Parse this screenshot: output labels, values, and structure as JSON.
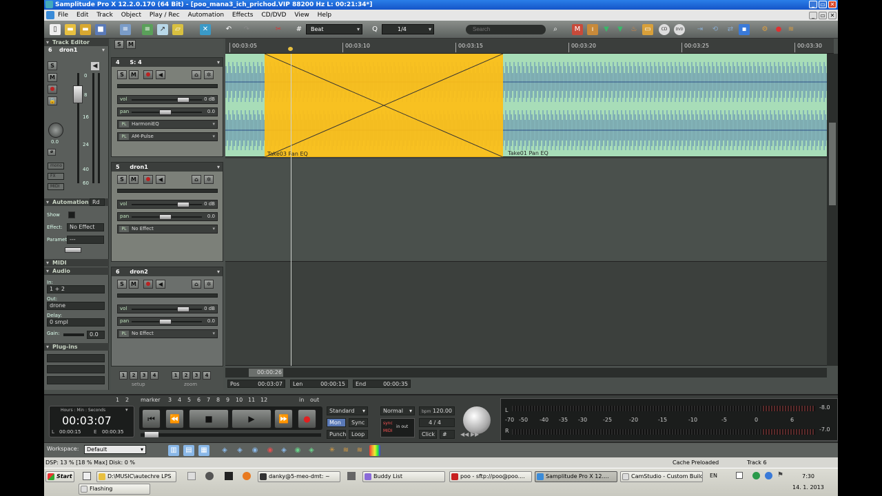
{
  "window": {
    "title": "Samplitude Pro X 12.2.0.170 (64 Bit) - [poo_mana3_ich_prichod.VIP   88200 Hz L: 00:21:34*]"
  },
  "menu": [
    "File",
    "Edit",
    "Track",
    "Object",
    "Play / Rec",
    "Automation",
    "Effects",
    "CD/DVD",
    "View",
    "Help"
  ],
  "toolbar": {
    "snap_mode": "Beat",
    "quantize_icon": "Q",
    "quantize_value": "1/4",
    "search_placeholder": "Search"
  },
  "track_editor": {
    "title": "Track Editor",
    "track_number": "6",
    "track_name": "dron1",
    "s_label": "S",
    "m_label": "M",
    "fader_value": "0.0",
    "mono_label": "mono",
    "fx_label": "FX",
    "midi_label": "MIDI",
    "scale_labels": [
      "0",
      "8",
      "16",
      "24",
      "40",
      "60"
    ],
    "automation_title": "Automation",
    "rd_label": "Rd",
    "show_label": "Show",
    "effect_label": "Effect:",
    "effect_value": "No Effect",
    "parameter_label": "Parameter",
    "parameter_value": "---",
    "midi_title": "MIDI",
    "audio_title": "Audio",
    "in_label": "In:",
    "in_value": "1 + 2",
    "out_label": "Out:",
    "out_value": "drone",
    "delay_label": "Delay:",
    "delay_value": "0 smpl",
    "gain_label": "Gain:",
    "gain_value": "0.0",
    "plugins_title": "Plug-ins"
  },
  "tracks": [
    {
      "num": "4",
      "name": "S: 4",
      "vol_label": "vol",
      "vol": "0 dB",
      "pan_label": "pan",
      "pan": "0.0",
      "fx": [
        {
          "pl": "PL",
          "name": "HarmoniEQ"
        },
        {
          "pl": "PL",
          "name": "AM-Pulse"
        }
      ]
    },
    {
      "num": "5",
      "name": "dron1",
      "vol_label": "vol",
      "vol": "0 dB",
      "pan_label": "pan",
      "pan": "0.0",
      "fx": [
        {
          "pl": "PL",
          "name": "No Effect"
        }
      ]
    },
    {
      "num": "6",
      "name": "dron2",
      "vol_label": "vol",
      "vol": "0 dB",
      "pan_label": "pan",
      "pan": "0.0",
      "fx": [
        {
          "pl": "PL",
          "name": "No Effect"
        }
      ]
    }
  ],
  "header_controls": {
    "setup_label": "setup",
    "zoom_label": "zoom",
    "setup_buttons": [
      "1",
      "2",
      "3",
      "4"
    ],
    "zoom_buttons": [
      "1",
      "2",
      "3",
      "4"
    ]
  },
  "ruler": {
    "ticks": [
      "00:03:05",
      "00:03:10",
      "00:03:15",
      "00:03:20",
      "00:03:25",
      "00:03:30"
    ]
  },
  "clips": {
    "selected_label": "Take03   Pan EQ",
    "main_label": "Take01   Pan EQ"
  },
  "scroll_time": "00:00:26",
  "position_bar": {
    "pos_label": "Pos",
    "pos_value": "00:03:07",
    "len_label": "Len",
    "len_value": "00:00:15",
    "end_label": "End",
    "end_value": "00:00:35"
  },
  "transport": {
    "marker_label": "marker",
    "marker_buttons": [
      "1",
      "2",
      "3",
      "4",
      "5",
      "6",
      "7",
      "8",
      "9",
      "10",
      "11",
      "12"
    ],
    "in_label": "in",
    "out_label": "out",
    "time_header": "Hours : Min : Seconds",
    "time": "00:03:07",
    "l_label": "L",
    "l_value": "00:00:15",
    "e_label": "E",
    "e_value": "00:00:35",
    "mode": "Standard",
    "mon_label": "Mon",
    "sync_label": "Sync",
    "punch_label": "Punch",
    "loop_label": "Loop",
    "normal_label": "Normal",
    "bpm_label": "bpm",
    "bpm": "120.00",
    "signature": "4 / 4",
    "click_label": "Click",
    "sync_box_line1": "sync",
    "sync_box_line2": "MIDI",
    "in_out_label": "in  out"
  },
  "meter": {
    "l_label": "L",
    "r_label": "R",
    "scale": [
      "-70",
      "-50",
      "-40",
      "-35",
      "-30",
      "-25",
      "-20",
      "-15",
      "-10",
      "-5",
      "0",
      "6"
    ],
    "right_top": "-8.0",
    "right_bottom": "-7.0"
  },
  "workspace": {
    "label": "Workspace:",
    "value": "Default"
  },
  "status": {
    "dsp": "DSP: 13 %  [18 % Max]   Disk:  0 %",
    "cache": "Cache Preloaded",
    "track": "Track 6"
  },
  "taskbar": {
    "start": "Start",
    "items": [
      "D:\\MUSIC\\autechre LPS",
      "danky@5-meo-dmt: ~",
      "Buddy List",
      "poo - sftp://poo@poo....",
      "Samplitude Pro X 12....",
      "CamStudio - Custom Build"
    ],
    "second_row": "Flashing",
    "lang": "EN",
    "clock": "7:30",
    "date": "14. 1. 2013"
  }
}
